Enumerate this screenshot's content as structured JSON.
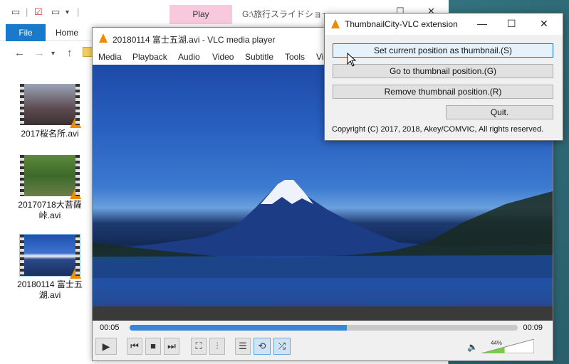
{
  "explorer": {
    "play_tab": "Play",
    "path_title": "G:\\旅行スライドショー",
    "ribbon": {
      "file": "File",
      "home": "Home"
    },
    "files": [
      {
        "name": "2017桜名所.avi"
      },
      {
        "name": "20170718大菩薩峠.avi"
      },
      {
        "name": "20180114 富士五湖.avi"
      }
    ]
  },
  "vlc": {
    "title": "20180114 富士五湖.avi - VLC media player",
    "menu": [
      "Media",
      "Playback",
      "Audio",
      "Video",
      "Subtitle",
      "Tools",
      "Vi"
    ],
    "time_current": "00:05",
    "time_total": "00:09",
    "progress_fraction": 0.56,
    "volume_text": "44%",
    "volume_fraction": 0.44,
    "accent": "#3a86d6"
  },
  "extension": {
    "title": "ThumbnailCity-VLC extension",
    "buttons": {
      "set": "Set current position as thumbnail.(S)",
      "go": "Go to thumbnail position.(G)",
      "remove": "Remove thumbnail position.(R)",
      "quit": "Quit."
    },
    "copyright": "Copyright (C) 2017, 2018, Akey/COMVIC, All rights reserved."
  }
}
